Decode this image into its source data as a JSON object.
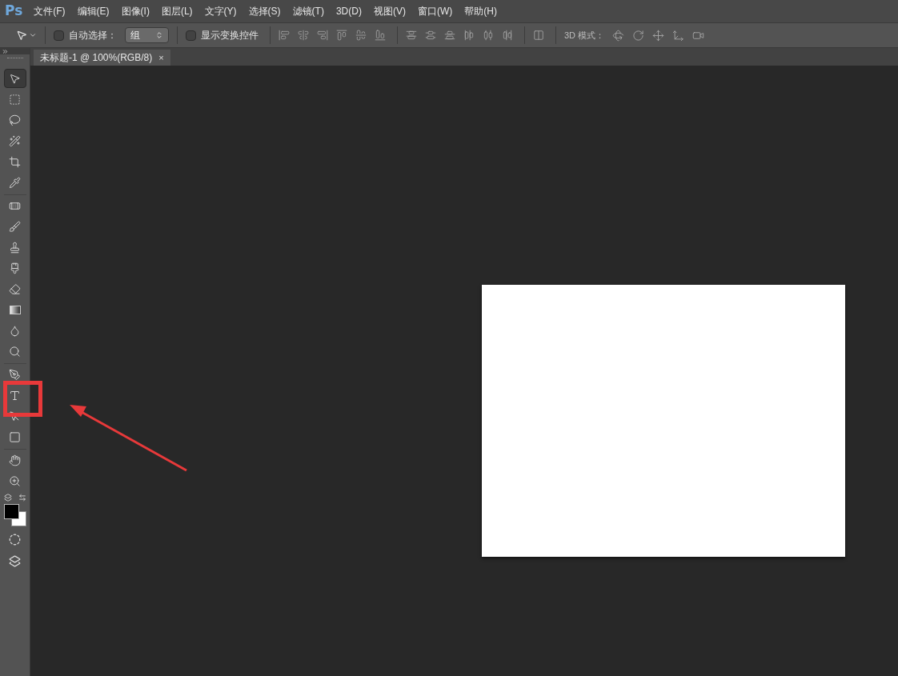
{
  "app_logo": "Ps",
  "menu": [
    "文件(F)",
    "编辑(E)",
    "图像(I)",
    "图层(L)",
    "文字(Y)",
    "选择(S)",
    "滤镜(T)",
    "3D(D)",
    "视图(V)",
    "窗口(W)",
    "帮助(H)"
  ],
  "options_bar": {
    "auto_select": {
      "label": "自动选择：",
      "checked": false
    },
    "auto_select_target": "组",
    "show_transform": {
      "label": "显示变换控件",
      "checked": false
    },
    "mode_3d_label": "3D 模式："
  },
  "document_tab": {
    "title": "未标题-1 @ 100%(RGB/8)",
    "close": "×"
  },
  "tools": [
    {
      "kind": "move",
      "selected": true
    },
    {
      "kind": "marquee",
      "selected": false
    },
    {
      "kind": "lasso",
      "selected": false
    },
    {
      "kind": "quick-select",
      "selected": false
    },
    {
      "kind": "crop",
      "selected": false
    },
    {
      "kind": "eyedropper",
      "selected": false
    },
    {
      "kind": "healing",
      "selected": false
    },
    {
      "kind": "brush",
      "selected": false
    },
    {
      "kind": "stamp",
      "selected": false
    },
    {
      "kind": "history-brush",
      "selected": false
    },
    {
      "kind": "eraser",
      "selected": false
    },
    {
      "kind": "gradient",
      "selected": false
    },
    {
      "kind": "blur",
      "selected": false
    },
    {
      "kind": "dodge",
      "selected": false
    },
    {
      "kind": "pen",
      "selected": false
    },
    {
      "kind": "type",
      "selected": false
    },
    {
      "kind": "path-select",
      "selected": false
    },
    {
      "kind": "shape",
      "selected": false
    },
    {
      "kind": "hand",
      "selected": false
    },
    {
      "kind": "zoom",
      "selected": false
    }
  ]
}
